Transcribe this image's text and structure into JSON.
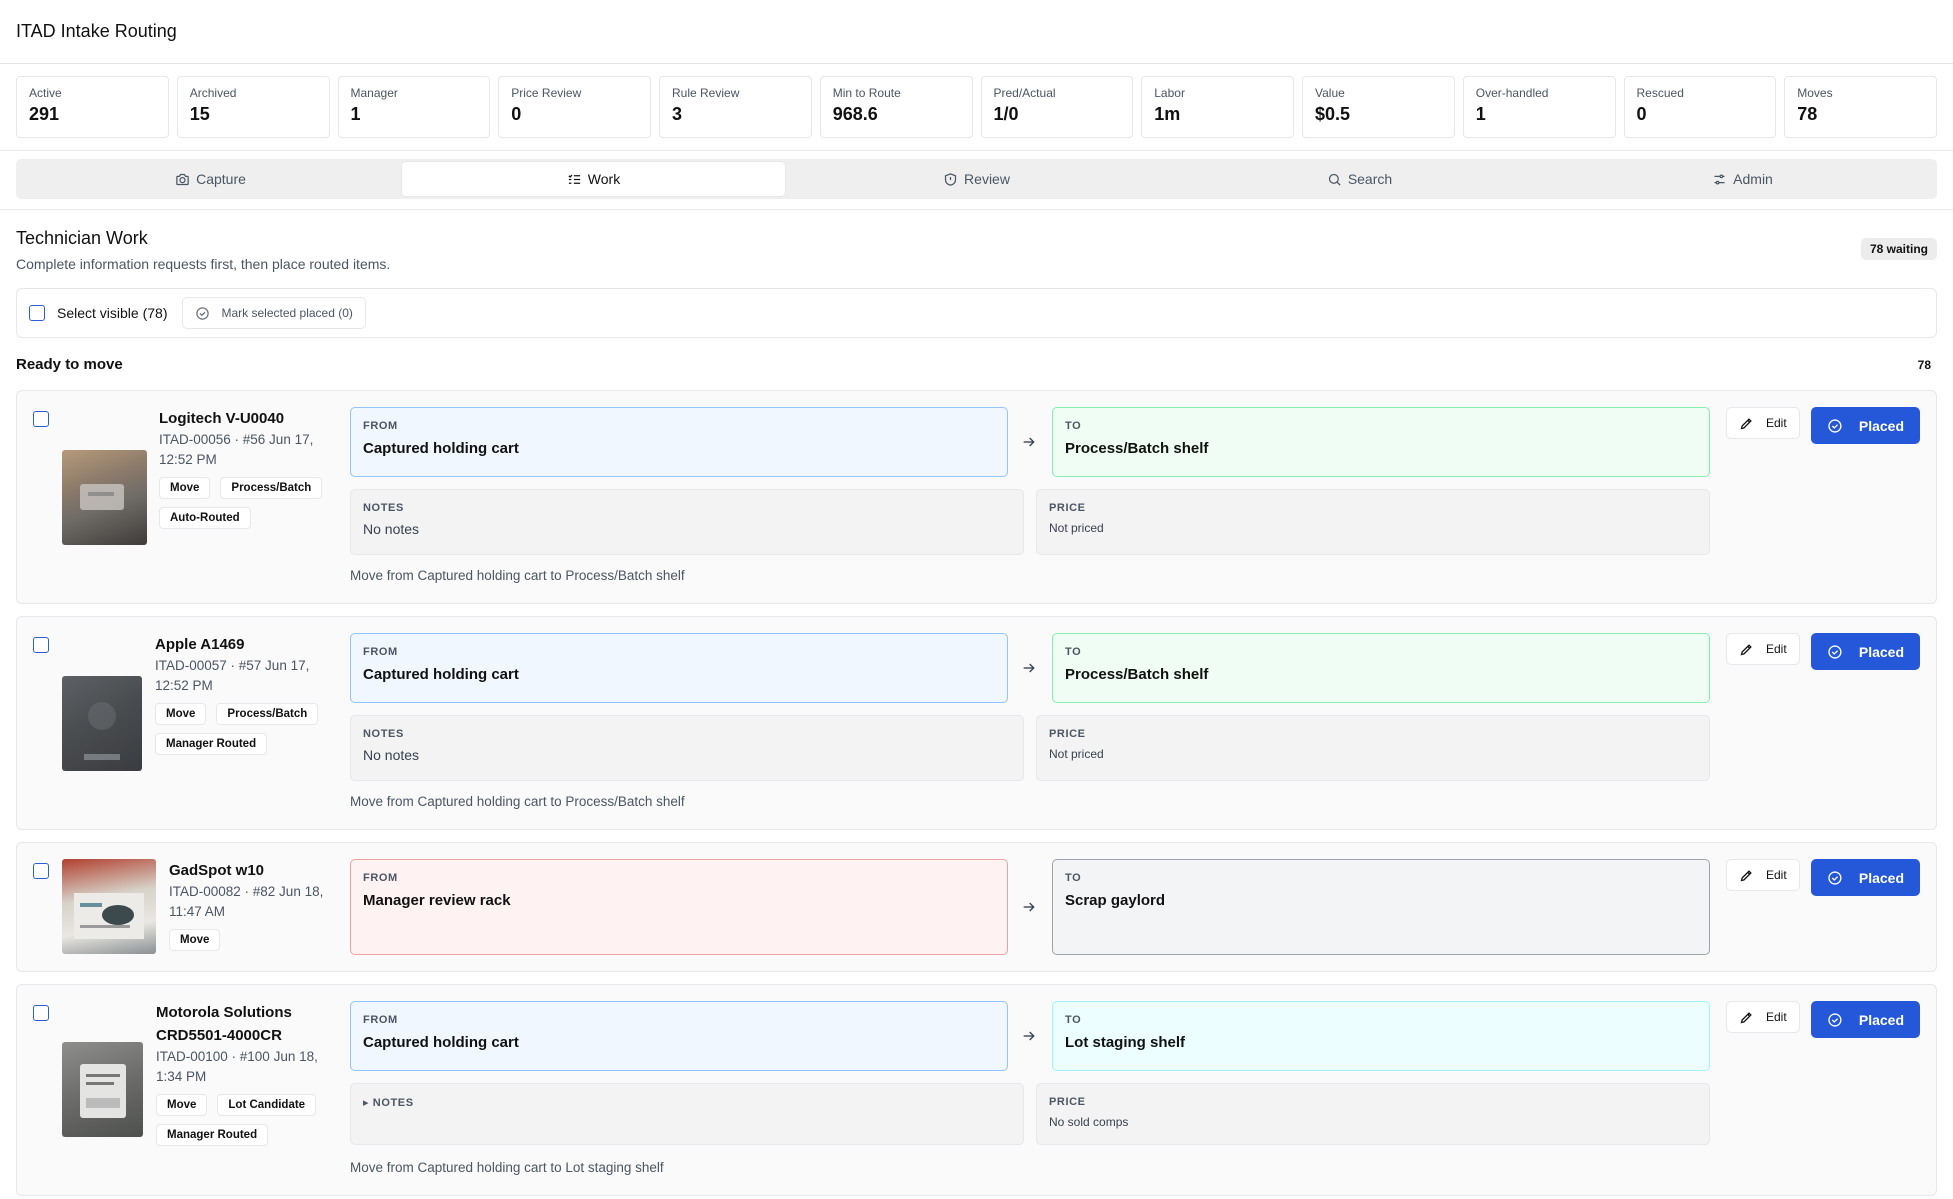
{
  "app": {
    "title": "ITAD Intake Routing"
  },
  "stats": [
    {
      "label": "Active",
      "value": "291"
    },
    {
      "label": "Archived",
      "value": "15"
    },
    {
      "label": "Manager",
      "value": "1"
    },
    {
      "label": "Price Review",
      "value": "0"
    },
    {
      "label": "Rule Review",
      "value": "3"
    },
    {
      "label": "Min to Route",
      "value": "968.6"
    },
    {
      "label": "Pred/Actual",
      "value": "1/0"
    },
    {
      "label": "Labor",
      "value": "1m"
    },
    {
      "label": "Value",
      "value": "$0.5"
    },
    {
      "label": "Over-handled",
      "value": "1"
    },
    {
      "label": "Rescued",
      "value": "0"
    },
    {
      "label": "Moves",
      "value": "78"
    }
  ],
  "tabs": [
    {
      "label": "Capture",
      "icon": "camera-icon"
    },
    {
      "label": "Work",
      "icon": "list-check-icon",
      "active": true
    },
    {
      "label": "Review",
      "icon": "shield-icon"
    },
    {
      "label": "Search",
      "icon": "search-icon"
    },
    {
      "label": "Admin",
      "icon": "sliders-icon"
    }
  ],
  "work": {
    "title": "Technician Work",
    "subtitle": "Complete information requests first, then place routed items.",
    "waiting_badge": "78 waiting",
    "select_visible": "Select visible (78)",
    "mark_selected": "Mark selected placed (0)",
    "ready_title": "Ready to move",
    "ready_count": "78"
  },
  "labels": {
    "from": "FROM",
    "to": "TO",
    "notes": "NOTES",
    "price": "PRICE",
    "edit": "Edit",
    "placed": "Placed"
  },
  "items": [
    {
      "name": "Logitech V-U0040",
      "meta": "ITAD-00056 · #56 Jun 17, 12:52 PM",
      "tags": [
        "Move",
        "Process/Batch",
        "Auto-Routed"
      ],
      "from": "Captured holding cart",
      "to": "Process/Batch shelf",
      "notes": "No notes",
      "price": "Not priced",
      "move_text": "Move from Captured holding cart to Process/Batch shelf"
    },
    {
      "name": "Apple A1469",
      "meta": "ITAD-00057 · #57 Jun 17, 12:52 PM",
      "tags": [
        "Move",
        "Process/Batch",
        "Manager Routed"
      ],
      "from": "Captured holding cart",
      "to": "Process/Batch shelf",
      "notes": "No notes",
      "price": "Not priced",
      "move_text": "Move from Captured holding cart to Process/Batch shelf"
    },
    {
      "name": "GadSpot w10",
      "meta": "ITAD-00082 · #82 Jun 18, 11:47 AM",
      "tags": [
        "Move"
      ],
      "from": "Manager review rack",
      "to": "Scrap gaylord"
    },
    {
      "name": "Motorola Solutions CRD5501-4000CR",
      "meta": "ITAD-00100 · #100 Jun 18, 1:34 PM",
      "tags": [
        "Move",
        "Lot Candidate",
        "Manager Routed"
      ],
      "from": "Captured holding cart",
      "to": "Lot staging shelf",
      "notes_collapsed": "▸ NOTES",
      "price": "No sold comps",
      "move_text": "Move from Captured holding cart to Lot staging shelf"
    }
  ]
}
